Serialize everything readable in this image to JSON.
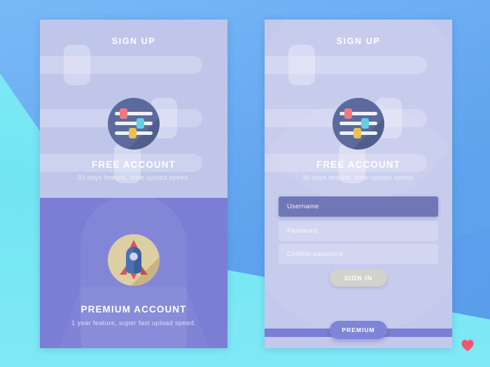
{
  "background": {
    "gradient_blue": "#5fa3ee",
    "gradient_cyan": "#76e6f4"
  },
  "cards": {
    "left": {
      "header": "SIGN UP",
      "free": {
        "title": "FREE ACCOUNT",
        "subtitle": "30 days feature, slow upload speed.",
        "icon": "sliders-icon"
      },
      "premium": {
        "title": "PREMIUM ACCOUNT",
        "subtitle": "1 year feature, super fast upload speed.",
        "icon": "rocket-icon"
      }
    },
    "right": {
      "header": "SIGN UP",
      "free": {
        "title": "FREE ACCOUNT",
        "subtitle": "30 days feature, slow upload speed.",
        "icon": "sliders-icon"
      },
      "form": {
        "username_placeholder": "Username",
        "password_placeholder": "Password",
        "confirm_placeholder": "Confirm password",
        "submit_label": "SIGN IN"
      },
      "premium_button": "PREMIUM"
    }
  },
  "colors": {
    "card_light": "#c3c8ec",
    "card_panel_top": "#bfc6ea",
    "card_panel_bottom": "#7b7ed4",
    "accent_purple": "#7b7ed4",
    "field_focus": "#7077b6",
    "signin_button": "#d3d2cc",
    "premium_pill": "#8084d8",
    "icon_circle_blue": "#5d6a9e",
    "icon_circle_tan": "#ddcfa4",
    "slider_red": "#ef7b82",
    "slider_cyan": "#63cfe6",
    "slider_yellow": "#e8c255",
    "rocket_body": "#4d6fb3",
    "rocket_red": "#d4585f",
    "heart": "#f2566a"
  },
  "footer": {
    "icon": "heart-icon"
  }
}
